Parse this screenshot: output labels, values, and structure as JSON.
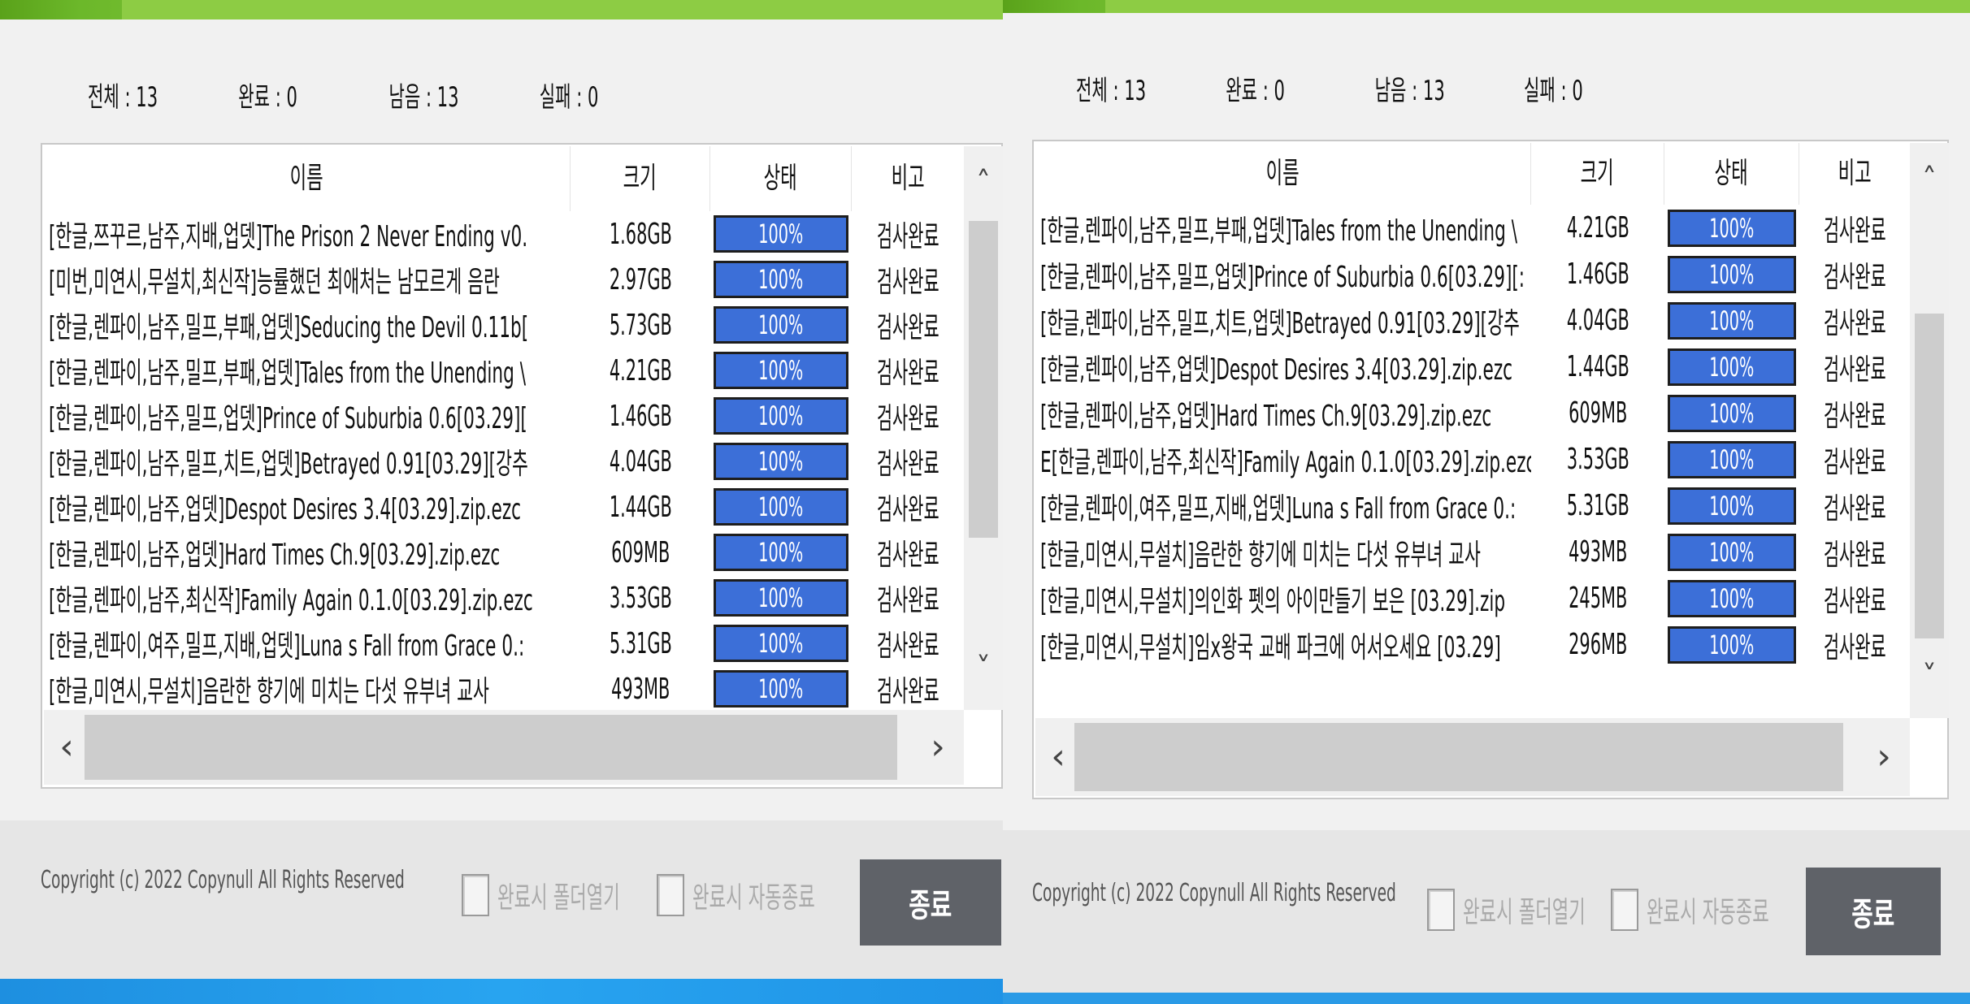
{
  "stats": {
    "total": "전체 : 13",
    "done": "완료 : 0",
    "remaining": "남음 : 13",
    "failed": "실패 : 0"
  },
  "columns": {
    "name": "이름",
    "size": "크기",
    "status": "상태",
    "note": "비고"
  },
  "windows": [
    {
      "rows": [
        {
          "name": "[한글,쯔꾸르,남주,지배,업뎃]The Prison 2 Never Ending v0.",
          "size": "1.68GB",
          "progress": "100%",
          "note": "검사완료"
        },
        {
          "name": "[미번,미연시,무설치,최신작]능률했던 최애처는 남모르게 음란",
          "size": "2.97GB",
          "progress": "100%",
          "note": "검사완료"
        },
        {
          "name": "[한글,렌파이,남주,밀프,부패,업뎃]Seducing the Devil 0.11b[",
          "size": "5.73GB",
          "progress": "100%",
          "note": "검사완료"
        },
        {
          "name": "[한글,렌파이,남주,밀프,부패,업뎃]Tales from the Unending \\",
          "size": "4.21GB",
          "progress": "100%",
          "note": "검사완료"
        },
        {
          "name": "[한글,렌파이,남주,밀프,업뎃]Prince of Suburbia 0.6[03.29][",
          "size": "1.46GB",
          "progress": "100%",
          "note": "검사완료"
        },
        {
          "name": "[한글,렌파이,남주,밀프,치트,업뎃]Betrayed 0.91[03.29][강추",
          "size": "4.04GB",
          "progress": "100%",
          "note": "검사완료"
        },
        {
          "name": "[한글,렌파이,남주,업뎃]Despot Desires 3.4[03.29].zip.ezc",
          "size": "1.44GB",
          "progress": "100%",
          "note": "검사완료"
        },
        {
          "name": "[한글,렌파이,남주,업뎃]Hard Times Ch.9[03.29].zip.ezc",
          "size": "609MB",
          "progress": "100%",
          "note": "검사완료"
        },
        {
          "name": "[한글,렌파이,남주,최신작]Family Again 0.1.0[03.29].zip.ezc",
          "size": "3.53GB",
          "progress": "100%",
          "note": "검사완료"
        },
        {
          "name": "[한글,렌파이,여주,밀프,지배,업뎃]Luna s Fall from Grace 0.:",
          "size": "5.31GB",
          "progress": "100%",
          "note": "검사완료"
        },
        {
          "name": "[한글,미연시,무설치]음란한 향기에 미치는 다섯 유부녀 교사",
          "size": "493MB",
          "progress": "100%",
          "note": "검사완료"
        }
      ]
    },
    {
      "rows": [
        {
          "name": "[한글,렌파이,남주,밀프,부패,업뎃]Tales from the Unending \\",
          "size": "4.21GB",
          "progress": "100%",
          "note": "검사완료"
        },
        {
          "name": "[한글,렌파이,남주,밀프,업뎃]Prince of Suburbia 0.6[03.29][:",
          "size": "1.46GB",
          "progress": "100%",
          "note": "검사완료"
        },
        {
          "name": "[한글,렌파이,남주,밀프,치트,업뎃]Betrayed 0.91[03.29][강추",
          "size": "4.04GB",
          "progress": "100%",
          "note": "검사완료"
        },
        {
          "name": "[한글,렌파이,남주,업뎃]Despot Desires 3.4[03.29].zip.ezc",
          "size": "1.44GB",
          "progress": "100%",
          "note": "검사완료"
        },
        {
          "name": "[한글,렌파이,남주,업뎃]Hard Times Ch.9[03.29].zip.ezc",
          "size": "609MB",
          "progress": "100%",
          "note": "검사완료"
        },
        {
          "name": "E[한글,렌파이,남주,최신작]Family Again 0.1.0[03.29].zip.ezc",
          "size": "3.53GB",
          "progress": "100%",
          "note": "검사완료"
        },
        {
          "name": "[한글,렌파이,여주,밀프,지배,업뎃]Luna s Fall from Grace 0.:",
          "size": "5.31GB",
          "progress": "100%",
          "note": "검사완료"
        },
        {
          "name": "[한글,미연시,무설치]음란한 향기에 미치는 다섯 유부녀 교사",
          "size": "493MB",
          "progress": "100%",
          "note": "검사완료"
        },
        {
          "name": "[한글,미연시,무설치]의인화 펫의 아이만들기 보은 [03.29].zip",
          "size": "245MB",
          "progress": "100%",
          "note": "검사완료"
        },
        {
          "name": "[한글,미연시,무설치]임x왕국 교배 파크에 어서오세요 [03.29]",
          "size": "296MB",
          "progress": "100%",
          "note": "검사완료"
        }
      ]
    }
  ],
  "footer": {
    "copyright": "Copyright (c) 2022 Copynull All Rights Reserved",
    "open_folder_label": "완료시 폴더열기",
    "auto_exit_label": "완료시 자동종료",
    "exit_label": "종료"
  },
  "icons": {
    "scroll_up": "chevron-up-icon",
    "scroll_down": "chevron-down-icon",
    "scroll_left": "chevron-left-icon",
    "scroll_right": "chevron-right-icon"
  },
  "colors": {
    "titlebar": "#7fc23a",
    "progress_fill": "#3c6fd8",
    "exit_button": "#5f6268"
  }
}
